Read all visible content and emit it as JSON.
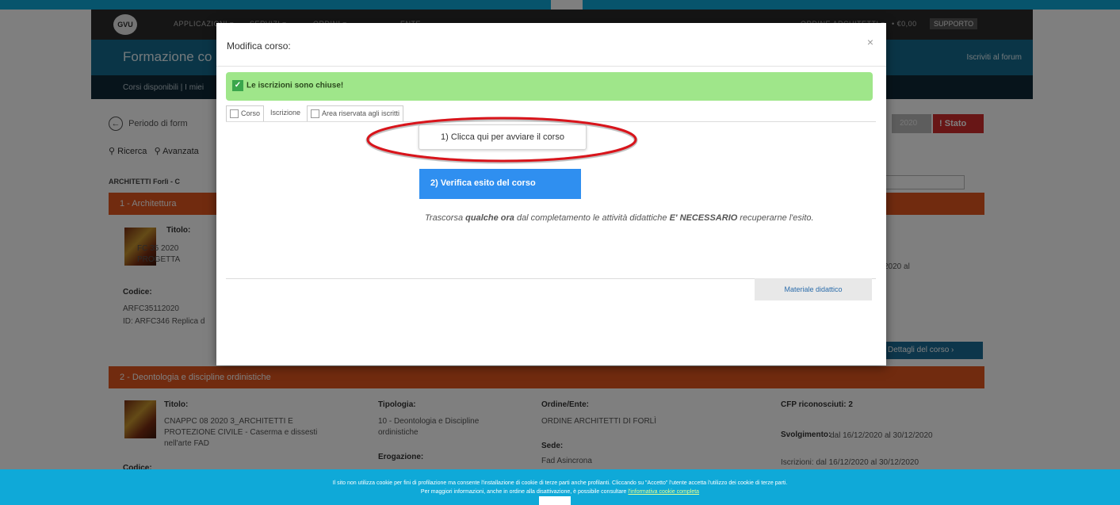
{
  "navbar": {
    "logo": "GVU",
    "items": [
      "APPLICAZIONI ▾",
      "SERVIZI ▾",
      "ORDINI ▾",
      "ENTE"
    ],
    "user": "ORDINE ARCHITETTI ▾",
    "lang": "• €0,00",
    "support_label": "SUPPORTO"
  },
  "subheader": {
    "title": "Formazione co",
    "forum": "Iscriviti al forum"
  },
  "crumbs": "Corsi disponibili | I miei",
  "content": {
    "back_label": "Periodo di form",
    "search": "Ricerca",
    "search2": "Avanzata",
    "filter_label": "ARCHITETTI Forlì - C",
    "status_label": "Stato",
    "year_label": "2020",
    "categories": [
      "1 - Architettura",
      "2 - Deontologia e discipline ordinistiche"
    ],
    "course1": {
      "title_label": "Titolo:",
      "title_text": "FC 35 2020",
      "title_text2": "PROGETTA",
      "code_label": "Codice:",
      "code_text": "ARFC35112020",
      "id_text": "ID: ARFC346 Replica d",
      "date_text": "2020 al",
      "details_button": "Dettagli del corso ›"
    },
    "course2": {
      "title_label": "Titolo:",
      "title_text": "CNAPPC 08 2020 3_ARCHITETTI E PROTEZIONE CIVILE - Caserma e dissesti nell'arte FAD",
      "type_label": "Tipologia:",
      "type_text": "10 - Deontologia e Discipline ordinistiche",
      "order_label": "Ordine/Ente:",
      "order_text": "ORDINE ARCHITETTI DI FORLÌ",
      "cfp_label": "CFP riconosciuti: 2",
      "sede_label": "Sede:",
      "sede_text": "Fad Asincrona",
      "dates_label": "Svolgimento:",
      "dates_text": "dal 16/12/2020 al 30/12/2020",
      "iscr_text": "Iscrizioni: dal 16/12/2020 al 30/12/2020",
      "code_label": "Codice:",
      "delivery_label": "Erogazione:"
    }
  },
  "modal": {
    "title": "Modifica corso:",
    "close": "×",
    "alert": "Le iscrizioni sono chiuse!",
    "tabs": [
      "Corso",
      "Iscrizione",
      "Area riservata agli iscritti"
    ],
    "tooltip": "1) Clicca qui per avviare il corso",
    "start_button": "2) Verifica esito del corso",
    "note_pre": "Trascorsa ",
    "note_bold1": "qualche ora",
    "note_mid": " dal completamento le attività didattiche ",
    "note_bold2": "E' NECESSARIO",
    "note_post": " recuperarne l'esito.",
    "material_button": "Materiale didattico"
  },
  "cookie": {
    "line1": "Il sito non utilizza cookie per fini di profilazione ma consente l'installazione di cookie di terze parti anche profilanti. Cliccando su \"Accetto\" l'utente accetta l'utilizzo dei cookie di terze parti.",
    "line2": "Per maggiori informazioni, anche in ordine alla disattivazione, è possibile consultare",
    "link": "l'informativa cookie completa"
  },
  "colors": {
    "accent": "#0fa9d8",
    "orange": "#e2561f",
    "green_alert": "#9fe68a",
    "annotation_ring": "#d9141b"
  }
}
